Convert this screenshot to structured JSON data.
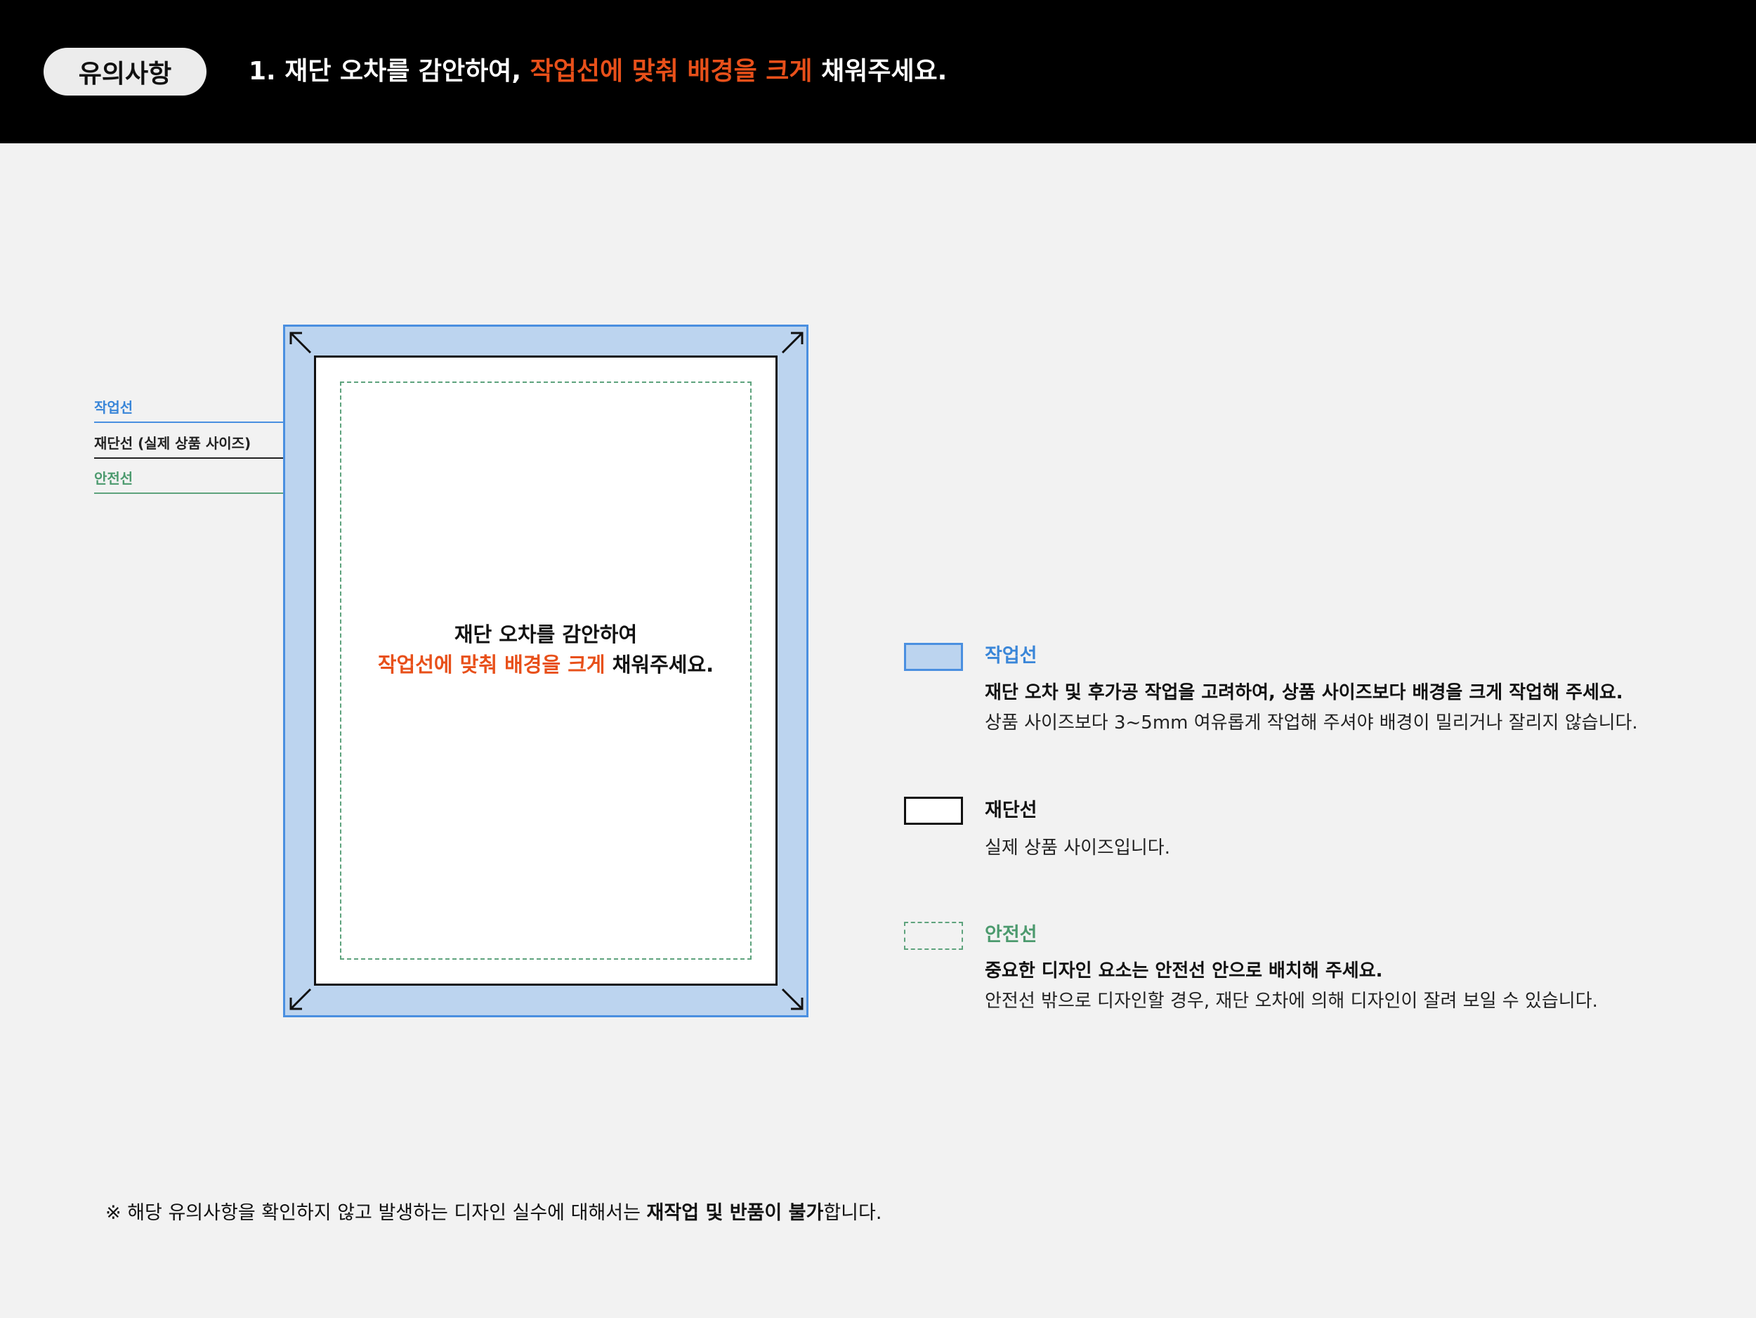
{
  "header": {
    "badge": "유의사항",
    "title_prefix": "1. 재단 오차를 감안하여, ",
    "title_highlight": "작업선에 맞춰 배경을 크게",
    "title_suffix": " 채워주세요."
  },
  "diagram": {
    "labels": {
      "bleed": "작업선",
      "trim": "재단선 (실제 상품 사이즈)",
      "safe": "안전선"
    },
    "center_line1": "재단 오차를 감안하여",
    "center_line2_highlight": "작업선에 맞춰 배경을 크게",
    "center_line2_suffix": " 채워주세요."
  },
  "legend": [
    {
      "title": "작업선",
      "bold": "재단 오차 및 후가공 작업을 고려하여, 상품 사이즈보다 배경을 크게 작업해 주세요.",
      "text": "상품 사이즈보다 3~5mm 여유롭게 작업해 주셔야 배경이 밀리거나 잘리지 않습니다."
    },
    {
      "title": "재단선",
      "text": "실제 상품 사이즈입니다."
    },
    {
      "title": "안전선",
      "bold": "중요한 디자인 요소는 안전선 안으로 배치해 주세요.",
      "text": "안전선 밖으로 디자인할 경우, 재단 오차에 의해 디자인이 잘려 보일 수 있습니다."
    }
  ],
  "footer": {
    "prefix": "※ 해당 유의사항을 확인하지 않고 발생하는 디자인 실수에 대해서는 ",
    "bold": "재작업 및 반품이 불가",
    "suffix": "합니다."
  },
  "colors": {
    "accent_orange": "#e8501a",
    "bleed_fill": "#bcd4ef",
    "bleed_border": "#4a8fe0",
    "trim_border": "#111111",
    "safe_line": "#5ea37d",
    "header_bg": "#000000",
    "page_bg": "#f2f2f2"
  }
}
